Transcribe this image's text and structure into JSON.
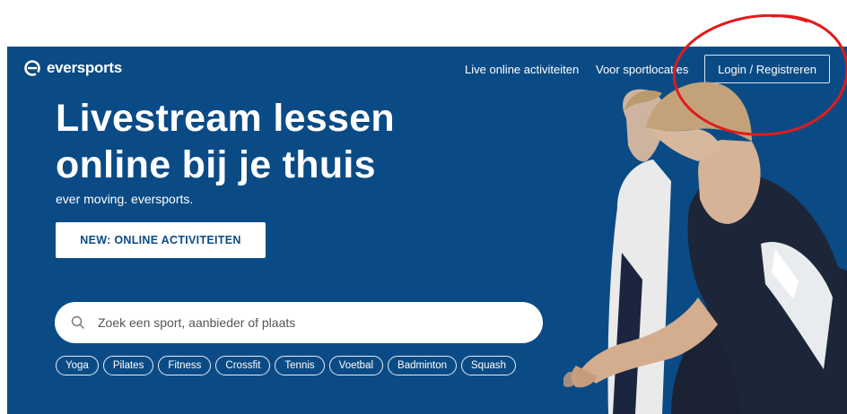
{
  "header": {
    "logo_text": "eversports",
    "nav": [
      {
        "label": "Live online activiteiten"
      },
      {
        "label": "Voor sportlocaties"
      }
    ],
    "login_label": "Login / Registreren"
  },
  "hero": {
    "title_line1": "Livestream lessen",
    "title_line2": "online bij je thuis",
    "tagline": "ever moving. eversports.",
    "cta_label": "NEW: ONLINE ACTIVITEITEN"
  },
  "search": {
    "placeholder": "Zoek een sport, aanbieder of plaats",
    "icon": "search-icon"
  },
  "sports": [
    "Yoga",
    "Pilates",
    "Fitness",
    "Crossfit",
    "Tennis",
    "Voetbal",
    "Badminton",
    "Squash"
  ],
  "colors": {
    "background": "#0b4b85",
    "annotation": "#e01b1b",
    "text": "#ffffff"
  }
}
